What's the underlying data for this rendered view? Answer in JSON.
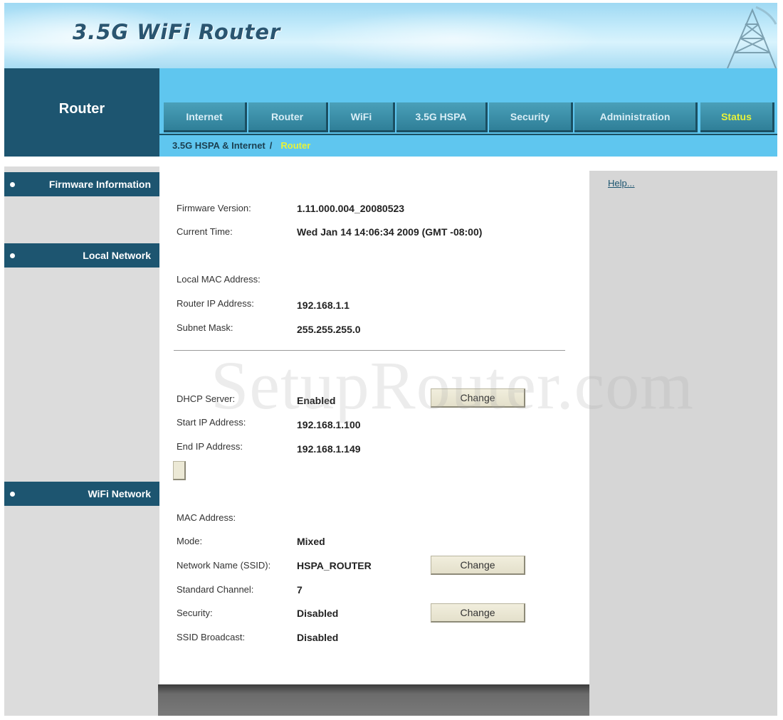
{
  "banner": {
    "title": "3.5G WiFi Router"
  },
  "section": {
    "title": "Router"
  },
  "tabs": [
    {
      "label": "Internet"
    },
    {
      "label": "Router"
    },
    {
      "label": "WiFi"
    },
    {
      "label": "3.5G HSPA"
    },
    {
      "label": "Security"
    },
    {
      "label": "Administration"
    },
    {
      "label": "Status",
      "active": true
    }
  ],
  "breadcrumb": {
    "parent": "3.5G HSPA & Internet",
    "separator": "/",
    "current": "Router"
  },
  "sidebar": {
    "items": [
      {
        "label": "Firmware Information"
      },
      {
        "label": "Local Network"
      },
      {
        "label": "WiFi Network"
      }
    ]
  },
  "firmware": {
    "version_label": "Firmware Version:",
    "version_value": "1.11.000.004_20080523",
    "time_label": "Current Time:",
    "time_value": "Wed Jan 14 14:06:34 2009 (GMT -08:00)"
  },
  "local": {
    "mac_label": "Local MAC Address:",
    "mac_value": "",
    "ip_label": "Router IP Address:",
    "ip_value": "192.168.1.1",
    "mask_label": "Subnet Mask:",
    "mask_value": "255.255.255.0",
    "dhcp_label": "DHCP Server:",
    "dhcp_value": "Enabled",
    "start_label": "Start IP Address:",
    "start_value": "192.168.1.100",
    "end_label": "End IP Address:",
    "end_value": "192.168.1.149",
    "change_label": "Change"
  },
  "wifi": {
    "mac_label": "MAC Address:",
    "mac_value": "",
    "mode_label": "Mode:",
    "mode_value": "Mixed",
    "ssid_label": "Network Name (SSID):",
    "ssid_value": "HSPA_ROUTER",
    "channel_label": "Standard Channel:",
    "channel_value": "7",
    "security_label": "Security:",
    "security_value": "Disabled",
    "broadcast_label": "SSID Broadcast:",
    "broadcast_value": "Disabled",
    "ssid_change_label": "Change",
    "security_change_label": "Change"
  },
  "help": {
    "link": "Help..."
  },
  "watermark": "SetupRouter.com",
  "colors": {
    "navy": "#1d5570",
    "tab_bar": "#5fc6ef",
    "active_tab_text": "#e8f23a",
    "sidebar_bg": "#dcdcdc"
  }
}
